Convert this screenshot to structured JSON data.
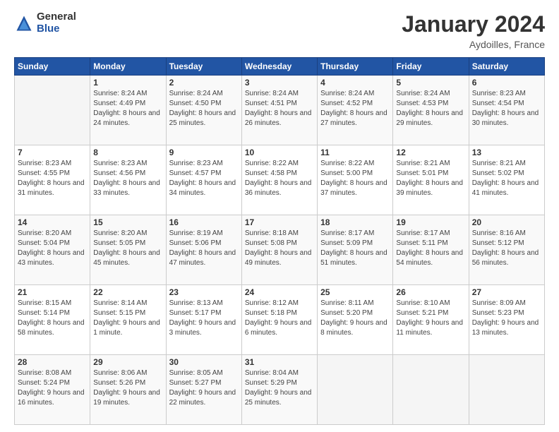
{
  "logo": {
    "general": "General",
    "blue": "Blue"
  },
  "title": "January 2024",
  "subtitle": "Aydoilles, France",
  "days_header": [
    "Sunday",
    "Monday",
    "Tuesday",
    "Wednesday",
    "Thursday",
    "Friday",
    "Saturday"
  ],
  "weeks": [
    [
      {
        "num": "",
        "detail": ""
      },
      {
        "num": "1",
        "detail": "Sunrise: 8:24 AM\nSunset: 4:49 PM\nDaylight: 8 hours\nand 24 minutes."
      },
      {
        "num": "2",
        "detail": "Sunrise: 8:24 AM\nSunset: 4:50 PM\nDaylight: 8 hours\nand 25 minutes."
      },
      {
        "num": "3",
        "detail": "Sunrise: 8:24 AM\nSunset: 4:51 PM\nDaylight: 8 hours\nand 26 minutes."
      },
      {
        "num": "4",
        "detail": "Sunrise: 8:24 AM\nSunset: 4:52 PM\nDaylight: 8 hours\nand 27 minutes."
      },
      {
        "num": "5",
        "detail": "Sunrise: 8:24 AM\nSunset: 4:53 PM\nDaylight: 8 hours\nand 29 minutes."
      },
      {
        "num": "6",
        "detail": "Sunrise: 8:23 AM\nSunset: 4:54 PM\nDaylight: 8 hours\nand 30 minutes."
      }
    ],
    [
      {
        "num": "7",
        "detail": "Sunrise: 8:23 AM\nSunset: 4:55 PM\nDaylight: 8 hours\nand 31 minutes."
      },
      {
        "num": "8",
        "detail": "Sunrise: 8:23 AM\nSunset: 4:56 PM\nDaylight: 8 hours\nand 33 minutes."
      },
      {
        "num": "9",
        "detail": "Sunrise: 8:23 AM\nSunset: 4:57 PM\nDaylight: 8 hours\nand 34 minutes."
      },
      {
        "num": "10",
        "detail": "Sunrise: 8:22 AM\nSunset: 4:58 PM\nDaylight: 8 hours\nand 36 minutes."
      },
      {
        "num": "11",
        "detail": "Sunrise: 8:22 AM\nSunset: 5:00 PM\nDaylight: 8 hours\nand 37 minutes."
      },
      {
        "num": "12",
        "detail": "Sunrise: 8:21 AM\nSunset: 5:01 PM\nDaylight: 8 hours\nand 39 minutes."
      },
      {
        "num": "13",
        "detail": "Sunrise: 8:21 AM\nSunset: 5:02 PM\nDaylight: 8 hours\nand 41 minutes."
      }
    ],
    [
      {
        "num": "14",
        "detail": "Sunrise: 8:20 AM\nSunset: 5:04 PM\nDaylight: 8 hours\nand 43 minutes."
      },
      {
        "num": "15",
        "detail": "Sunrise: 8:20 AM\nSunset: 5:05 PM\nDaylight: 8 hours\nand 45 minutes."
      },
      {
        "num": "16",
        "detail": "Sunrise: 8:19 AM\nSunset: 5:06 PM\nDaylight: 8 hours\nand 47 minutes."
      },
      {
        "num": "17",
        "detail": "Sunrise: 8:18 AM\nSunset: 5:08 PM\nDaylight: 8 hours\nand 49 minutes."
      },
      {
        "num": "18",
        "detail": "Sunrise: 8:17 AM\nSunset: 5:09 PM\nDaylight: 8 hours\nand 51 minutes."
      },
      {
        "num": "19",
        "detail": "Sunrise: 8:17 AM\nSunset: 5:11 PM\nDaylight: 8 hours\nand 54 minutes."
      },
      {
        "num": "20",
        "detail": "Sunrise: 8:16 AM\nSunset: 5:12 PM\nDaylight: 8 hours\nand 56 minutes."
      }
    ],
    [
      {
        "num": "21",
        "detail": "Sunrise: 8:15 AM\nSunset: 5:14 PM\nDaylight: 8 hours\nand 58 minutes."
      },
      {
        "num": "22",
        "detail": "Sunrise: 8:14 AM\nSunset: 5:15 PM\nDaylight: 9 hours\nand 1 minute."
      },
      {
        "num": "23",
        "detail": "Sunrise: 8:13 AM\nSunset: 5:17 PM\nDaylight: 9 hours\nand 3 minutes."
      },
      {
        "num": "24",
        "detail": "Sunrise: 8:12 AM\nSunset: 5:18 PM\nDaylight: 9 hours\nand 6 minutes."
      },
      {
        "num": "25",
        "detail": "Sunrise: 8:11 AM\nSunset: 5:20 PM\nDaylight: 9 hours\nand 8 minutes."
      },
      {
        "num": "26",
        "detail": "Sunrise: 8:10 AM\nSunset: 5:21 PM\nDaylight: 9 hours\nand 11 minutes."
      },
      {
        "num": "27",
        "detail": "Sunrise: 8:09 AM\nSunset: 5:23 PM\nDaylight: 9 hours\nand 13 minutes."
      }
    ],
    [
      {
        "num": "28",
        "detail": "Sunrise: 8:08 AM\nSunset: 5:24 PM\nDaylight: 9 hours\nand 16 minutes."
      },
      {
        "num": "29",
        "detail": "Sunrise: 8:06 AM\nSunset: 5:26 PM\nDaylight: 9 hours\nand 19 minutes."
      },
      {
        "num": "30",
        "detail": "Sunrise: 8:05 AM\nSunset: 5:27 PM\nDaylight: 9 hours\nand 22 minutes."
      },
      {
        "num": "31",
        "detail": "Sunrise: 8:04 AM\nSunset: 5:29 PM\nDaylight: 9 hours\nand 25 minutes."
      },
      {
        "num": "",
        "detail": ""
      },
      {
        "num": "",
        "detail": ""
      },
      {
        "num": "",
        "detail": ""
      }
    ]
  ]
}
